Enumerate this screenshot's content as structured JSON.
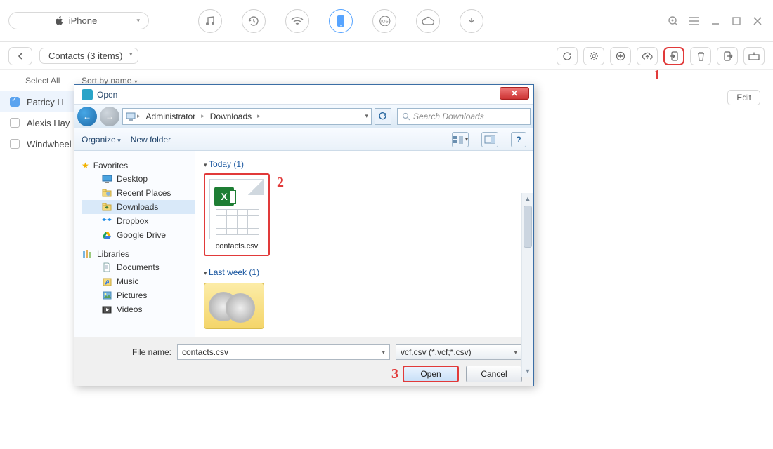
{
  "topbar": {
    "device_label": "iPhone"
  },
  "bar2": {
    "breadcrumb": "Contacts (3 items)"
  },
  "colhead": {
    "select_all": "Select All",
    "sort": "Sort by name"
  },
  "contacts": [
    {
      "name": "Patricy H"
    },
    {
      "name": "Alexis Hay"
    },
    {
      "name": "Windwheel"
    }
  ],
  "edit_label": "Edit",
  "annotations": {
    "a1": "1",
    "a2": "2",
    "a3": "3"
  },
  "dialog": {
    "title": "Open",
    "path": {
      "seg1": "Administrator",
      "seg2": "Downloads"
    },
    "search_placeholder": "Search Downloads",
    "organize": "Organize",
    "newfolder": "New folder",
    "side": {
      "fav": "Favorites",
      "desktop": "Desktop",
      "recent": "Recent Places",
      "downloads": "Downloads",
      "dropbox": "Dropbox",
      "gdrive": "Google Drive",
      "libs": "Libraries",
      "docs": "Documents",
      "music": "Music",
      "pics": "Pictures",
      "vids": "Videos"
    },
    "groups": {
      "today": "Today (1)",
      "lastweek": "Last week (1)"
    },
    "file_caption": "contacts.csv",
    "filename_label": "File name:",
    "filename_value": "contacts.csv",
    "filetype": "vcf,csv (*.vcf;*.csv)",
    "open": "Open",
    "cancel": "Cancel"
  }
}
